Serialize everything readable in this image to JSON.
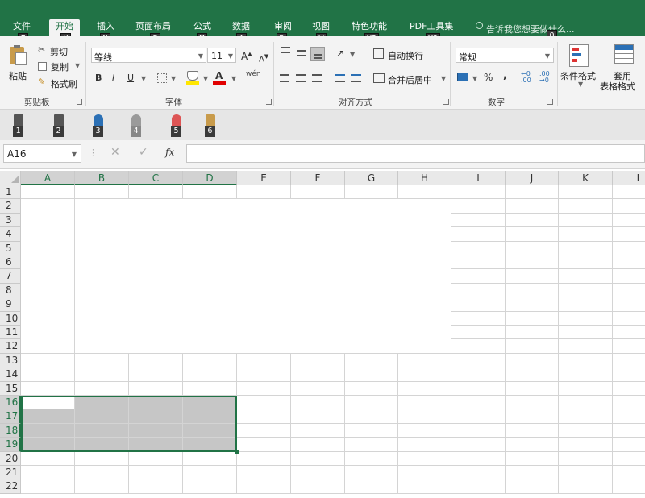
{
  "tabs": [
    {
      "label": "文件",
      "key": "F"
    },
    {
      "label": "开始",
      "key": "H"
    },
    {
      "label": "插入",
      "key": "N"
    },
    {
      "label": "页面布局",
      "key": "P"
    },
    {
      "label": "公式",
      "key": "M"
    },
    {
      "label": "数据",
      "key": "A"
    },
    {
      "label": "审阅",
      "key": "R"
    },
    {
      "label": "视图",
      "key": "W"
    },
    {
      "label": "特色功能",
      "key": "Y2"
    },
    {
      "label": "PDF工具集",
      "key": "Y3"
    }
  ],
  "tell_me": {
    "placeholder": "告诉我您想要做什么...",
    "key": "Q"
  },
  "clipboard": {
    "paste": "粘贴",
    "cut": "剪切",
    "copy": "复制",
    "format_painter": "格式刷",
    "group": "剪贴板"
  },
  "font": {
    "name": "等线",
    "size": "11",
    "group": "字体",
    "bold": "B",
    "italic": "I",
    "underline": "U",
    "phonetic": "wén"
  },
  "alignment": {
    "wrap": "自动换行",
    "merge": "合并后居中",
    "group": "对齐方式"
  },
  "number": {
    "format": "常规",
    "percent": "%",
    "comma": ",",
    "group": "数字"
  },
  "styles": {
    "conditional": "条件格式",
    "table_line1": "套用",
    "table_line2": "表格格式"
  },
  "qat_keys": [
    "1",
    "2",
    "3",
    "4",
    "5",
    "6"
  ],
  "formula_bar": {
    "name_box": "A16",
    "fx": "fx",
    "formula": ""
  },
  "columns": [
    "A",
    "B",
    "C",
    "D",
    "E",
    "F",
    "G",
    "H",
    "I",
    "J",
    "K",
    "L"
  ],
  "rows": [
    "1",
    "2",
    "3",
    "4",
    "5",
    "6",
    "7",
    "8",
    "9",
    "10",
    "11",
    "12",
    "13",
    "14",
    "15",
    "16",
    "17",
    "18",
    "19",
    "20",
    "21",
    "22"
  ],
  "selection": {
    "active_cell": "A16",
    "range": "A16:D19"
  },
  "colors": {
    "excel_green": "#217346",
    "selection_fill": "#c6c6c6"
  }
}
